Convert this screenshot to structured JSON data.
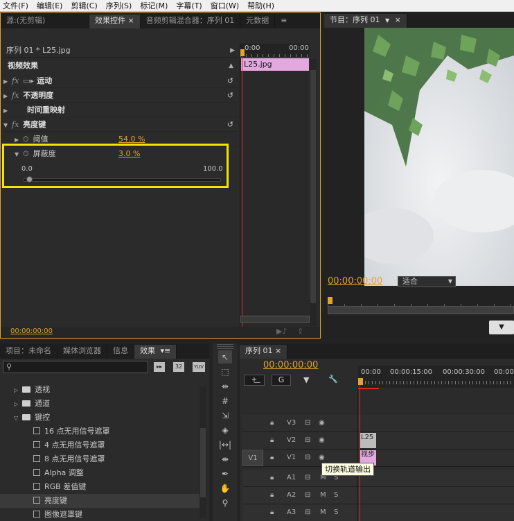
{
  "menu": [
    "文件(F)",
    "编辑(E)",
    "剪辑(C)",
    "序列(S)",
    "标记(M)",
    "字幕(T)",
    "窗口(W)",
    "帮助(H)"
  ],
  "effect_controls": {
    "tabs": [
      "源:(无剪辑)",
      "效果控件 ×",
      "音频剪辑混合器：序列 01",
      "元数据"
    ],
    "menu_icon": "≡",
    "clip_path": "序列 01 * L25.jpg",
    "section_title": "视频效果",
    "effects": [
      {
        "label": "运动"
      },
      {
        "label": "不透明度"
      },
      {
        "label": "时间重映射"
      },
      {
        "label": "亮度键"
      }
    ],
    "threshold": {
      "label": "阈值",
      "value": "54.0 %"
    },
    "cutoff": {
      "label": "屏蔽度",
      "value": "3.0 %",
      "min": "0.0",
      "max": "100.0",
      "slider_fraction": 0.03
    },
    "timeline_start": "0:00",
    "timeline_end": "00:00",
    "clip_label": "L25.jpg",
    "timecode": "00:00:00:00"
  },
  "program_monitor": {
    "title": "节目：序列 01",
    "timecode": "00:00:00:00",
    "fit": "适合"
  },
  "project_panel": {
    "tabs": [
      "项目：未命名",
      "媒体浏览器",
      "信息",
      "效果"
    ],
    "search_placeholder": "",
    "badges": [
      "32",
      "YUV"
    ],
    "items": [
      {
        "label": "透视",
        "type": "folder"
      },
      {
        "label": "通道",
        "type": "folder"
      },
      {
        "label": "键控",
        "type": "folder-open"
      },
      {
        "label": "16 点无用信号遮罩",
        "type": "effect"
      },
      {
        "label": "4 点无用信号遮罩",
        "type": "effect"
      },
      {
        "label": "8 点无用信号遮罩",
        "type": "effect"
      },
      {
        "label": "Alpha 调整",
        "type": "effect"
      },
      {
        "label": "RGB 差值键",
        "type": "effect"
      },
      {
        "label": "亮度键",
        "type": "effect"
      },
      {
        "label": "图像遮罩键",
        "type": "effect"
      }
    ]
  },
  "timeline": {
    "tab": "序列 01 ×",
    "timecode": "00:00:00:00",
    "ruler": [
      "00:00",
      "00:00:15:00",
      "00:00:30:00",
      "00:00"
    ],
    "tracks": [
      {
        "name": "V3"
      },
      {
        "name": "V2"
      },
      {
        "name": "V1",
        "source": "V1"
      },
      {
        "name": "A1"
      },
      {
        "name": "A2"
      },
      {
        "name": "A3"
      }
    ],
    "clip_v2": "L25",
    "clip_v1": "视步",
    "tooltip": "切换轨道输出",
    "m_label": "M",
    "s_label": "S"
  },
  "colors": {
    "accent_orange": "#e1a42e",
    "highlight_yellow": "#f2e600",
    "clip_pink": "#e3a8e0",
    "playhead": "#d92b2b"
  }
}
